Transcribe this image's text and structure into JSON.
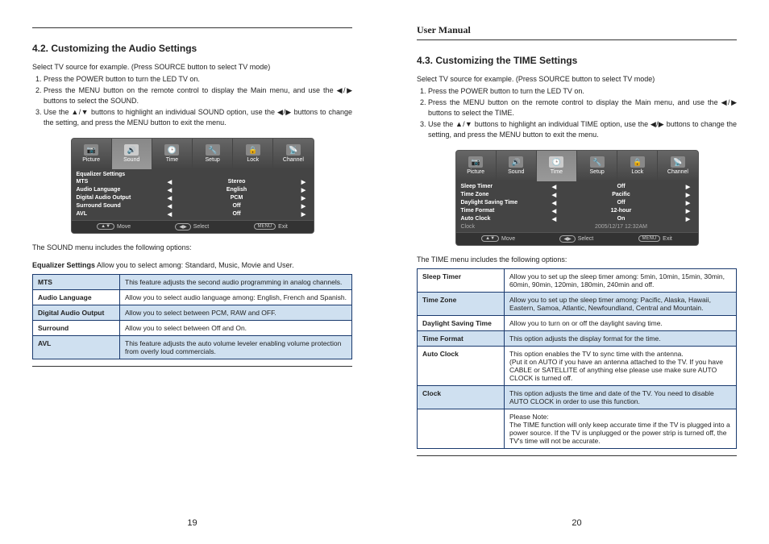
{
  "header": {
    "user_manual": "User Manual"
  },
  "left": {
    "title": "4.2. Customizing the Audio Settings",
    "intro": "Select TV source for example. (Press SOURCE button to select TV mode)",
    "step1": "Press the POWER button to turn the LED TV on.",
    "step2": "Press the MENU button on the remote control to display the Main menu, and use the  ◀/▶ buttons to select the SOUND.",
    "step3": "Use the  ▲/▼  buttons to highlight an individual SOUND option, use the  ◀/▶ buttons to change the setting, and press the MENU button to exit the menu.",
    "osd": {
      "tabs": [
        "Picture",
        "Sound",
        "Time",
        "Setup",
        "Lock",
        "Channel"
      ],
      "rows": [
        {
          "label": "Equalizer Settings",
          "val": ""
        },
        {
          "label": "MTS",
          "val": "Stereo"
        },
        {
          "label": "Audio Language",
          "val": "English"
        },
        {
          "label": "Digital Audio Output",
          "val": "PCM"
        },
        {
          "label": "Surround Sound",
          "val": "Off"
        },
        {
          "label": "AVL",
          "val": "Off"
        }
      ],
      "foot": {
        "move": "Move",
        "select": "Select",
        "exit": "Exit",
        "menu": "MENU"
      }
    },
    "after1": "The SOUND menu includes the following options:",
    "after2a": "Equalizer Settings",
    "after2b": "   Allow you to select among: Standard, Music, Movie and User.",
    "tbl": [
      {
        "k": "MTS",
        "v": "This feature adjusts the second audio programming in analog channels."
      },
      {
        "k": "Audio Language",
        "v": "Allow you to select audio language among: English, French and Spanish."
      },
      {
        "k": "Digital Audio Output",
        "v": "Allow you to select between PCM, RAW and OFF."
      },
      {
        "k": "Surround",
        "v": "Allow you to select between Off and On."
      },
      {
        "k": "AVL",
        "v": "This feature adjusts the auto volume leveler enabling volume protection from overly loud commercials."
      }
    ],
    "pgnum": "19"
  },
  "right": {
    "title": "4.3. Customizing the TIME Settings",
    "intro": "Select TV source for example. (Press SOURCE button to select TV mode)",
    "step1": "Press the POWER button to turn the LED TV on.",
    "step2": "Press the MENU button on the remote control to display the Main menu, and use the  ◀/▶ buttons to select the TIME.",
    "step3": "Use the  ▲/▼  buttons to highlight an individual TIME option, use the  ◀/▶ buttons to change the setting, and press the MENU button to exit the menu.",
    "osd": {
      "tabs": [
        "Picture",
        "Sound",
        "Time",
        "Setup",
        "Lock",
        "Channel"
      ],
      "rows": [
        {
          "label": "Sleep Timer",
          "val": "Off"
        },
        {
          "label": "Time Zone",
          "val": "Pacific"
        },
        {
          "label": "Daylight Saving Time",
          "val": "Off"
        },
        {
          "label": "Time Format",
          "val": "12-hour"
        },
        {
          "label": "Auto Clock",
          "val": "On"
        },
        {
          "label": "Clock",
          "val": "2005/12/17 12:32AM",
          "dim": true
        }
      ],
      "foot": {
        "move": "Move",
        "select": "Select",
        "exit": "Exit",
        "menu": "MENU"
      }
    },
    "after1": "The TIME menu includes the following options:",
    "tbl": [
      {
        "k": "Sleep Timer",
        "v": "Allow you to set up the sleep timer among: 5min, 10min, 15min, 30min,  60min, 90min, 120min, 180min, 240min and off."
      },
      {
        "k": "Time Zone",
        "v": "Allow you to set up the sleep timer among: Pacific, Alaska, Hawaii, Eastern, Samoa, Atlantic, Newfoundland, Central and Mountain."
      },
      {
        "k": "Daylight Saving Time",
        "v": "Allow you to turn on or off the daylight saving time."
      },
      {
        "k": "Time Format",
        "v": "This option adjusts the display format for the time."
      },
      {
        "k": "Auto Clock",
        "v": "This option enables the TV to sync time with the antenna.\n(Put it on AUTO if you have an antenna attached to the TV. If you have CABLE or SATELLITE of anything else please use make sure AUTO CLOCK is turned off."
      },
      {
        "k": "Clock",
        "v": "This option adjusts the time and date of the TV. You need to disable AUTO CLOCK in order to use this function."
      }
    ],
    "note1": "Please Note:",
    "note2": "The TIME function will only keep accurate time if the TV is plugged into a power source. If the TV is unplugged or the power strip is turned off, the TV's time will not be accurate.",
    "pgnum": "20"
  }
}
